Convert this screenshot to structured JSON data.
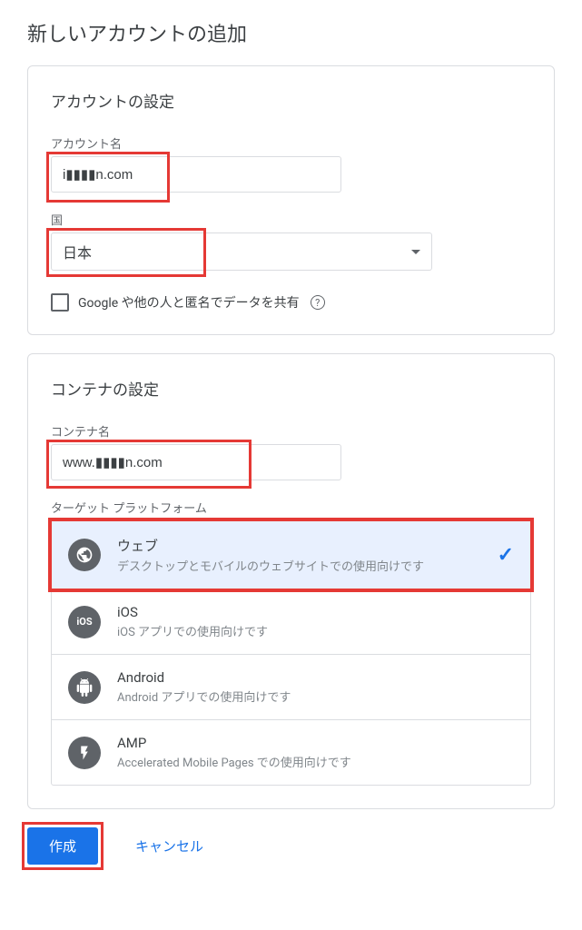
{
  "page_title": "新しいアカウントの追加",
  "account": {
    "section_title": "アカウントの設定",
    "name_label": "アカウント名",
    "name_value": "i▮▮▮▮n.com",
    "country_label": "国",
    "country_value": "日本",
    "share_label": "Google や他の人と匿名でデータを共有"
  },
  "container": {
    "section_title": "コンテナの設定",
    "name_label": "コンテナ名",
    "name_value": "www.▮▮▮▮n.com",
    "platform_label": "ターゲット プラットフォーム",
    "platforms": [
      {
        "name": "ウェブ",
        "desc": "デスクトップとモバイルのウェブサイトでの使用向けです",
        "selected": true
      },
      {
        "name": "iOS",
        "desc": "iOS アプリでの使用向けです",
        "selected": false
      },
      {
        "name": "Android",
        "desc": "Android アプリでの使用向けです",
        "selected": false
      },
      {
        "name": "AMP",
        "desc": "Accelerated Mobile Pages での使用向けです",
        "selected": false
      }
    ]
  },
  "buttons": {
    "create": "作成",
    "cancel": "キャンセル"
  }
}
